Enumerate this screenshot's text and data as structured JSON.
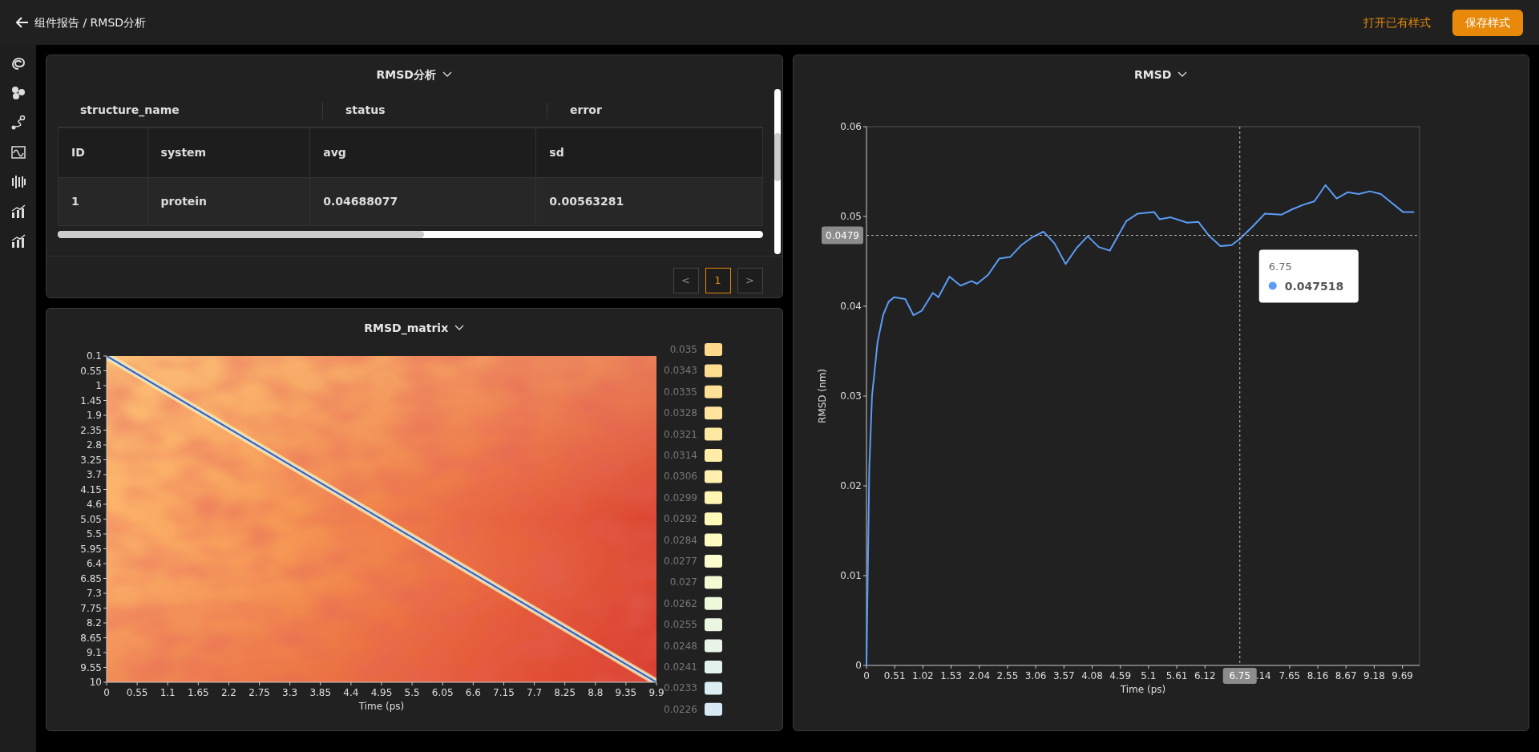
{
  "header": {
    "breadcrumb": "组件报告 / RMSD分析",
    "actions": [
      {
        "label": "打开已有样式",
        "kind": "link"
      },
      {
        "label": "保存样式",
        "kind": "primary"
      }
    ]
  },
  "table_panel": {
    "title": "RMSD分析",
    "group_headers": [
      "structure_name",
      "status",
      "error"
    ],
    "columns": [
      "ID",
      "system",
      "avg",
      "sd"
    ],
    "rows": [
      [
        "1",
        "protein",
        "0.04688077",
        "0.00563281"
      ]
    ],
    "pagination": {
      "prev": "<",
      "next": ">",
      "pages": [
        {
          "label": "1",
          "selected": true
        }
      ]
    }
  },
  "heatmap_panel": {
    "title": "RMSD_matrix",
    "xlabel": "Time (ps)",
    "y_axis_labels": [
      "0.1",
      "0.55",
      "1",
      "1.45",
      "1.9",
      "2.35",
      "2.8",
      "3.25",
      "3.7",
      "4.15",
      "4.6",
      "5.05",
      "5.5",
      "5.95",
      "6.4",
      "6.85",
      "7.3",
      "7.75",
      "8.2",
      "8.65",
      "9.1",
      "9.55",
      "10"
    ],
    "x_axis_labels": [
      "0",
      "0.55",
      "1.1",
      "1.65",
      "2.2",
      "2.75",
      "3.3",
      "3.85",
      "4.4",
      "4.95",
      "5.5",
      "6.05",
      "6.6",
      "7.15",
      "7.7",
      "8.25",
      "8.8",
      "9.35",
      "9.9"
    ],
    "legend": [
      {
        "label": "0.035",
        "color": "#fed98b"
      },
      {
        "label": "0.0343",
        "color": "#fedc90"
      },
      {
        "label": "0.0335",
        "color": "#fee096"
      },
      {
        "label": "0.0328",
        "color": "#fee49c"
      },
      {
        "label": "0.0321",
        "color": "#fee8a2"
      },
      {
        "label": "0.0314",
        "color": "#feeca8"
      },
      {
        "label": "0.0306",
        "color": "#fff0ad"
      },
      {
        "label": "0.0299",
        "color": "#fff4b2"
      },
      {
        "label": "0.0292",
        "color": "#fff9ba"
      },
      {
        "label": "0.0284",
        "color": "#fffcc2"
      },
      {
        "label": "0.0277",
        "color": "#fbfdcc"
      },
      {
        "label": "0.027",
        "color": "#f3fad4"
      },
      {
        "label": "0.0262",
        "color": "#eef8da"
      },
      {
        "label": "0.0255",
        "color": "#ebf6e0"
      },
      {
        "label": "0.0248",
        "color": "#e8f5e6"
      },
      {
        "label": "0.0241",
        "color": "#e3f2ec"
      },
      {
        "label": "0.0233",
        "color": "#dcedf3"
      },
      {
        "label": "0.0226",
        "color": "#d6e9f4"
      }
    ]
  },
  "line_panel": {
    "title": "RMSD",
    "chart_data": {
      "type": "line",
      "xlabel": "Time (ps)",
      "ylabel": "RMSD (nm)",
      "xlim": [
        0,
        10
      ],
      "ylim": [
        0,
        0.06
      ],
      "x": [
        0,
        0.05,
        0.1,
        0.2,
        0.3,
        0.4,
        0.5,
        0.7,
        0.85,
        1.0,
        1.2,
        1.3,
        1.5,
        1.7,
        1.9,
        2.0,
        2.2,
        2.4,
        2.6,
        2.8,
        3.0,
        3.2,
        3.4,
        3.6,
        3.8,
        4.0,
        4.2,
        4.4,
        4.7,
        4.9,
        5.2,
        5.3,
        5.5,
        5.8,
        6.0,
        6.2,
        6.4,
        6.6,
        6.75,
        7.0,
        7.2,
        7.5,
        7.7,
        7.9,
        8.1,
        8.3,
        8.5,
        8.7,
        8.9,
        9.1,
        9.3,
        9.5,
        9.7,
        9.9
      ],
      "series": [
        {
          "color": "#5b9cf6",
          "values": [
            0,
            0.022,
            0.03,
            0.036,
            0.039,
            0.0405,
            0.041,
            0.0408,
            0.039,
            0.0395,
            0.0415,
            0.041,
            0.0433,
            0.0423,
            0.0428,
            0.0425,
            0.0435,
            0.0453,
            0.0455,
            0.0468,
            0.0477,
            0.0483,
            0.047,
            0.0447,
            0.0465,
            0.0478,
            0.0466,
            0.0462,
            0.0495,
            0.0503,
            0.0505,
            0.0497,
            0.0499,
            0.0493,
            0.0494,
            0.0478,
            0.0467,
            0.0468,
            0.0475,
            0.049,
            0.0503,
            0.0502,
            0.0508,
            0.0513,
            0.0517,
            0.0535,
            0.052,
            0.0527,
            0.0525,
            0.0528,
            0.0525,
            0.0515,
            0.0505,
            0.0505
          ]
        }
      ],
      "xticks": [
        0,
        0.51,
        1.02,
        1.53,
        2.04,
        2.55,
        3.06,
        3.57,
        4.08,
        4.59,
        5.1,
        5.61,
        6.12,
        7.65,
        8.16,
        8.67,
        9.18,
        9.69
      ],
      "ref_lines": [
        {
          "axis": "x",
          "value": 6.75,
          "label": "6.75"
        },
        {
          "axis": "y",
          "value": 0.0479,
          "label": "0.0479"
        }
      ],
      "yticks": [
        0,
        0.01,
        0.02,
        0.03,
        0.04,
        0.05,
        0.06
      ]
    },
    "covered_tick_text": ".14",
    "tooltip": {
      "title": "6.75",
      "value": "0.047518"
    }
  }
}
